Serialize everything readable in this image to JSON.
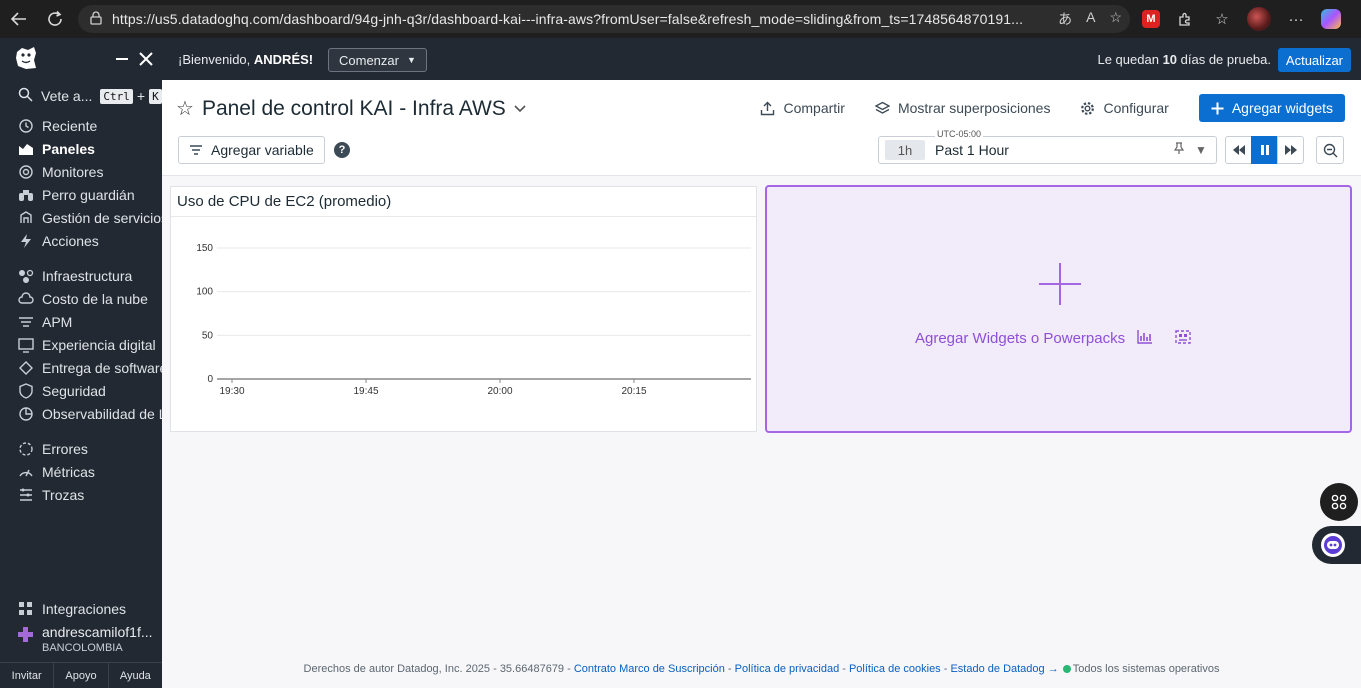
{
  "browser": {
    "url": "https://us5.datadoghq.com/dashboard/94g-jnh-q3r/dashboard-kai---infra-aws?fromUser=false&refresh_mode=sliding&from_ts=1748564870191..."
  },
  "sidebar": {
    "search_label": "Vete a...",
    "search_kbd1": "Ctrl",
    "search_plus": "+",
    "search_kbd2": "K",
    "group1": [
      {
        "label": "Reciente",
        "icon": "history-icon"
      },
      {
        "label": "Paneles",
        "icon": "dashboards-icon",
        "active": true
      },
      {
        "label": "Monitores",
        "icon": "monitors-icon"
      },
      {
        "label": "Perro guardián",
        "icon": "binoculars-icon"
      },
      {
        "label": "Gestión de servicios",
        "icon": "service-management-icon"
      },
      {
        "label": "Acciones",
        "icon": "bolt-icon"
      }
    ],
    "group2": [
      {
        "label": "Infraestructura",
        "icon": "infrastructure-icon"
      },
      {
        "label": "Costo de la nube",
        "icon": "cloud-cost-icon"
      },
      {
        "label": "APM",
        "icon": "apm-icon"
      },
      {
        "label": "Experiencia digital",
        "icon": "digital-experience-icon"
      },
      {
        "label": "Entrega de software",
        "icon": "software-delivery-icon"
      },
      {
        "label": "Seguridad",
        "icon": "shield-icon"
      },
      {
        "label": "Observabilidad de L",
        "icon": "llm-observability-icon"
      }
    ],
    "group3": [
      {
        "label": "Errores",
        "icon": "errors-icon"
      },
      {
        "label": "Métricas",
        "icon": "metrics-icon"
      },
      {
        "label": "Trozas",
        "icon": "logs-icon"
      }
    ],
    "integrations": "Integraciones",
    "user_name": "andrescamilof1f...",
    "user_org": "BANCOLOMBIA",
    "footer": {
      "invite": "Invitar",
      "support": "Apoyo",
      "help": "Ayuda"
    }
  },
  "banner": {
    "welcome_prefix": "¡Bienvenido, ",
    "welcome_name": "ANDRÉS!",
    "start_label": "Comenzar",
    "trial_prefix": "Le quedan ",
    "trial_days": "10",
    "trial_suffix": " días de prueba.",
    "upgrade_label": "Actualizar"
  },
  "header": {
    "title": "Panel de control KAI - Infra AWS",
    "share": "Compartir",
    "overlays": "Mostrar superposiciones",
    "configure": "Configurar",
    "add_widgets": "Agregar widgets",
    "add_variable": "Agregar variable",
    "help": "?",
    "timezone": "UTC-05:00",
    "time_chip": "1h",
    "time_label": "Past 1 Hour"
  },
  "widget": {
    "title": "Uso de CPU de EC2 (promedio)"
  },
  "dropzone": {
    "label": "Agregar Widgets o Powerpacks"
  },
  "chart_data": {
    "type": "line",
    "title": "Uso de CPU de EC2 (promedio)",
    "x_ticks": [
      "19:30",
      "19:45",
      "20:00",
      "20:15"
    ],
    "y_ticks": [
      0,
      50,
      100,
      150
    ],
    "ylim": [
      0,
      150
    ],
    "series": [],
    "grid": true
  },
  "footer": {
    "copyright": "Derechos de autor Datadog, Inc. 2025 - 35.66487679 - ",
    "contract": "Contrato Marco de Suscripción",
    "privacy": "Política de privacidad",
    "cookies": "Política de cookies",
    "status": "Estado de Datadog →",
    "systems": "Todos los sistemas operativos",
    "sep": " - "
  },
  "colors": {
    "accent": "#0a6fd1",
    "sidebar_bg": "#232932",
    "dropzone_border": "#a566e3",
    "dropzone_text": "#8f4fd6",
    "status_ok": "#2ab673"
  }
}
